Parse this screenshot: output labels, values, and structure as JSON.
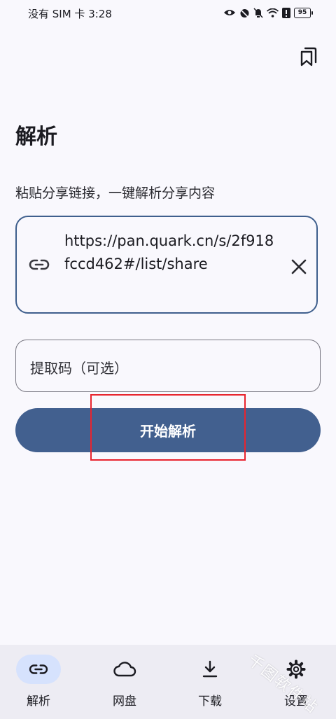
{
  "status_bar": {
    "carrier_time": "没有 SIM 卡 3:28",
    "battery_level": "95",
    "icons": [
      "eye-icon",
      "alarm-icon",
      "mute-icon",
      "wifi-icon",
      "alert-icon",
      "battery-icon"
    ]
  },
  "header": {
    "bookmark_icon": "bookmark-icon"
  },
  "page": {
    "title": "解析",
    "subtitle": "粘贴分享链接，一键解析分享内容"
  },
  "link_field": {
    "value": "https://pan.quark.cn/s/2f918fccd462#/list/share",
    "leading_icon": "link-icon",
    "trailing_icon": "close-icon"
  },
  "code_field": {
    "placeholder": "提取码（可选）",
    "value": ""
  },
  "actions": {
    "start_label": "开始解析"
  },
  "bottom_nav": {
    "items": [
      {
        "label": "解析",
        "icon": "link-icon",
        "active": true
      },
      {
        "label": "网盘",
        "icon": "cloud-icon",
        "active": false
      },
      {
        "label": "下载",
        "icon": "download-icon",
        "active": false
      },
      {
        "label": "设置",
        "icon": "gear-icon",
        "active": false
      }
    ]
  },
  "colors": {
    "accent": "#42608f",
    "active_nav_pill": "#d6e2fd",
    "highlight": "#e8242e",
    "background": "#f9f8fd"
  },
  "watermark": "千图软件站"
}
